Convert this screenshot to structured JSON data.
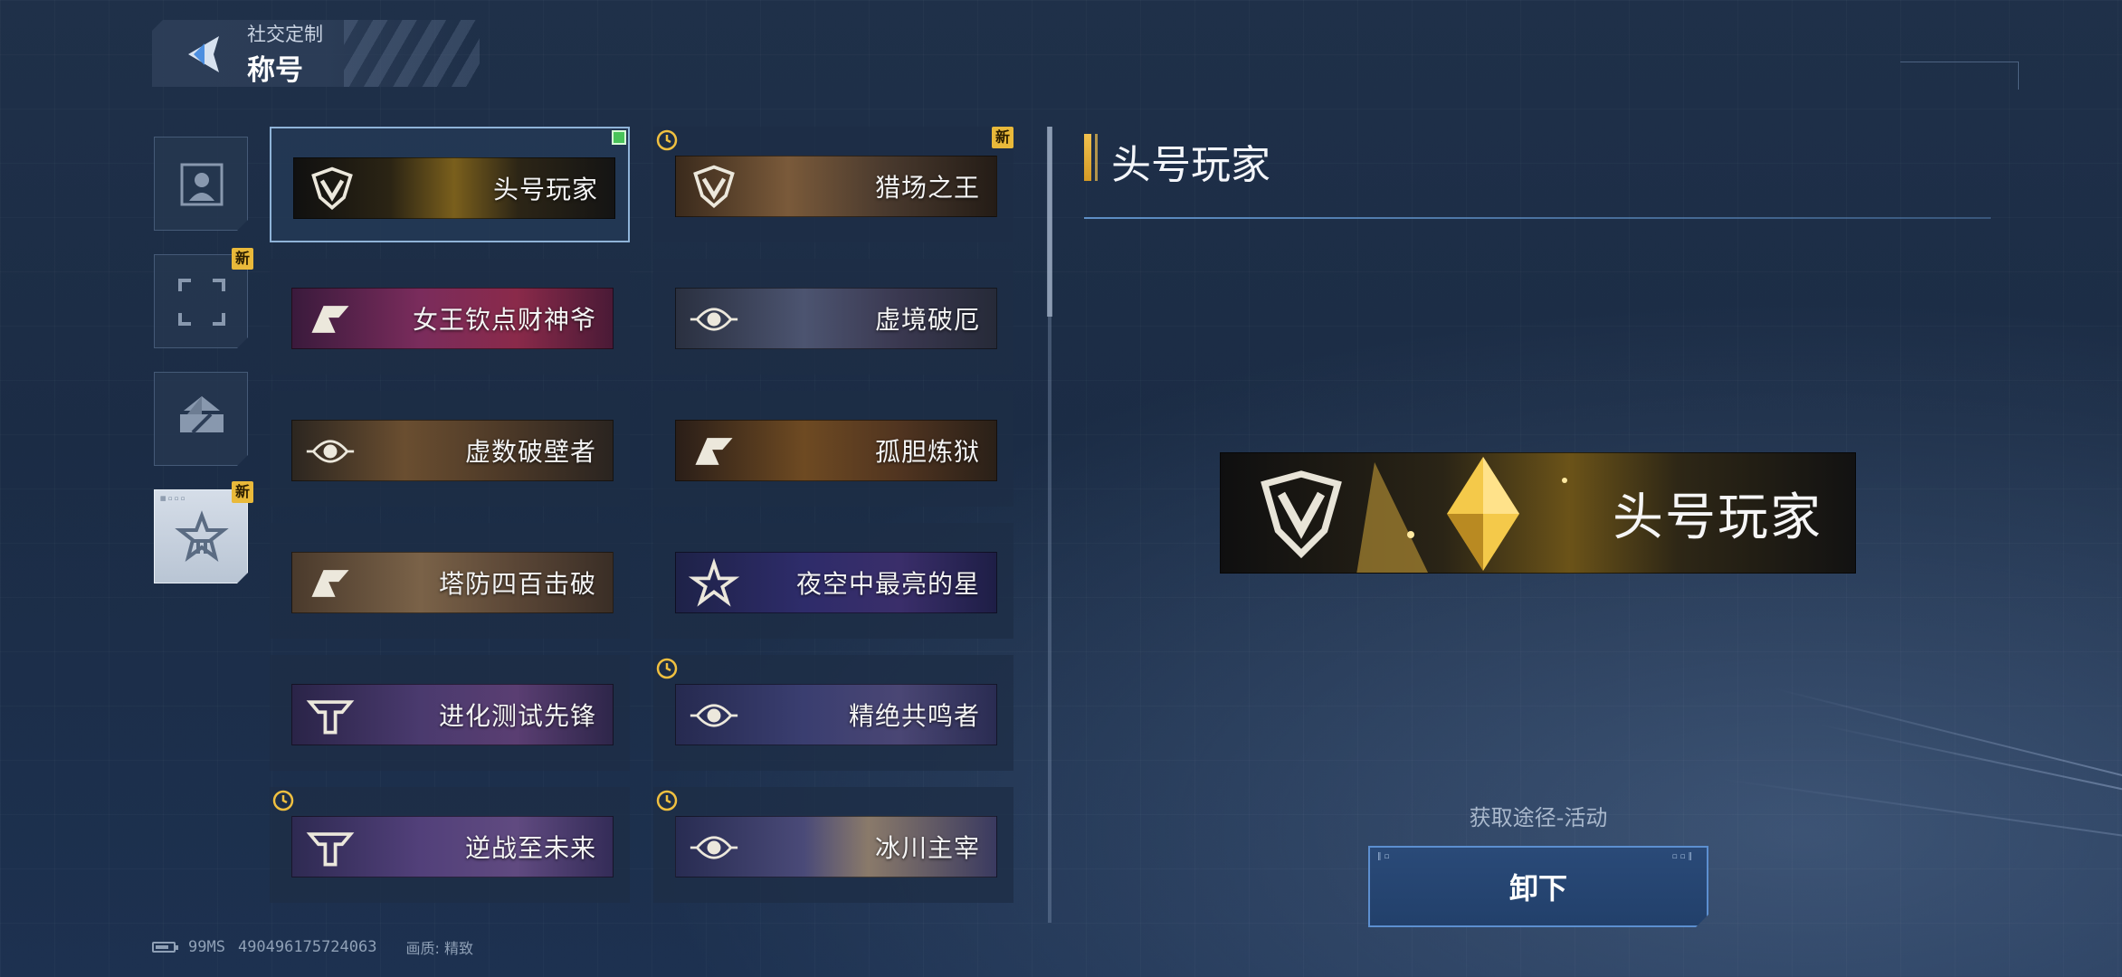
{
  "header": {
    "subtitle": "社交定制",
    "title": "称号"
  },
  "categories": [
    {
      "name": "portrait",
      "icon": "portrait-icon",
      "new": false,
      "active": false
    },
    {
      "name": "frame",
      "icon": "frame-corners-icon",
      "new": true,
      "active": false
    },
    {
      "name": "nameplate",
      "icon": "nameplate-icon",
      "new": false,
      "active": false
    },
    {
      "name": "title",
      "icon": "star-emblem-icon",
      "new": true,
      "active": true
    }
  ],
  "badges": {
    "new": "新"
  },
  "titles": [
    {
      "label": "头号玩家",
      "theme": "gold",
      "selected": true,
      "equipped": true,
      "timed": false,
      "new": false
    },
    {
      "label": "猎场之王",
      "theme": "bronze",
      "selected": false,
      "equipped": false,
      "timed": true,
      "new": true
    },
    {
      "label": "女王钦点财神爷",
      "theme": "magenta",
      "selected": false,
      "equipped": false,
      "timed": false,
      "new": false
    },
    {
      "label": "虚境破厄",
      "theme": "slate",
      "selected": false,
      "equipped": false,
      "timed": false,
      "new": false
    },
    {
      "label": "虚数破壁者",
      "theme": "amber",
      "selected": false,
      "equipped": false,
      "timed": false,
      "new": false
    },
    {
      "label": "孤胆炼狱",
      "theme": "ember",
      "selected": false,
      "equipped": false,
      "timed": false,
      "new": false
    },
    {
      "label": "塔防四百击破",
      "theme": "sand",
      "selected": false,
      "equipped": false,
      "timed": false,
      "new": false
    },
    {
      "label": "夜空中最亮的星",
      "theme": "night",
      "selected": false,
      "equipped": false,
      "timed": false,
      "new": false
    },
    {
      "label": "进化测试先锋",
      "theme": "violet",
      "selected": false,
      "equipped": false,
      "timed": false,
      "new": false
    },
    {
      "label": "精绝共鸣者",
      "theme": "indigo",
      "selected": false,
      "equipped": false,
      "timed": true,
      "new": false
    },
    {
      "label": "逆战至未来",
      "theme": "purple",
      "selected": false,
      "equipped": false,
      "timed": true,
      "new": false
    },
    {
      "label": "冰川主宰",
      "theme": "glacier",
      "selected": false,
      "equipped": false,
      "timed": true,
      "new": false
    }
  ],
  "detail": {
    "title": "头号玩家",
    "preview_label": "头号玩家",
    "source": "获取途径-活动",
    "action_label": "卸下"
  },
  "status": {
    "ping": "99MS",
    "id": "490496175724063",
    "quality": "画质: 精致"
  },
  "colors": {
    "accent_gold": "#f2c14e",
    "button_blue": "#22406b",
    "equipped_green": "#49c35a",
    "new_badge": "#e9b93a"
  }
}
